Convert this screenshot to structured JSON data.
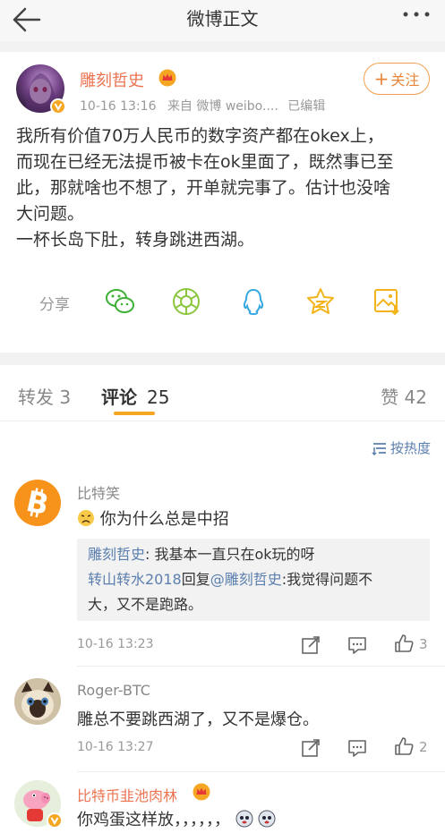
{
  "topbar": {
    "title": "微博正文",
    "back_icon": "arrow-left-icon",
    "more_icon": "ellipsis-icon"
  },
  "post": {
    "author": "雕刻哲史",
    "time": "10-16  13:16",
    "source": "来自  微博  weibo....",
    "edited": "已编辑",
    "follow_label": "关注",
    "text_lines": [
      "我所有价值70万人民币的数字资产都在okex上，",
      "而现在已经无法提币被卡在ok里面了，既然事已至",
      "此，那就啥也不想了，开单就完事了。估计也没啥",
      "大问题。",
      "一杯长岛下肚，转身跳进西湖。"
    ],
    "share_label": "分享",
    "share_icons": [
      "wechat-icon",
      "moments-icon",
      "qq-icon",
      "qzone-icon",
      "save-image-icon"
    ]
  },
  "tabs": {
    "repost": "转发 3",
    "comments_label": "评论",
    "comments_count": "25",
    "likes": "赞 42",
    "sort_label": "按热度"
  },
  "comments": [
    {
      "name": "比特笑",
      "text": "你为什么总是中招",
      "time": "10-16  13:23",
      "likes": "3",
      "replies": [
        {
          "author": "雕刻哲史",
          "text": "我基本一直只在ok玩的呀"
        },
        {
          "author": "转山转水2018",
          "reply_word": "回复",
          "mention": "@雕刻哲史",
          "text_line1": ":我觉得问题不",
          "text_line2": "大，又不是跑路。"
        }
      ]
    },
    {
      "name": "Roger-BTC",
      "text": "雕总不要跳西湖了，又不是爆仓。",
      "time": "10-16  13:27",
      "likes": "2"
    },
    {
      "name": "比特币韭池肉林",
      "text": "你鸡蛋这样放，，，，，，"
    }
  ],
  "colors": {
    "accent": "#f5a623",
    "link": "#5b7fae",
    "name_orange": "#eb7350"
  }
}
